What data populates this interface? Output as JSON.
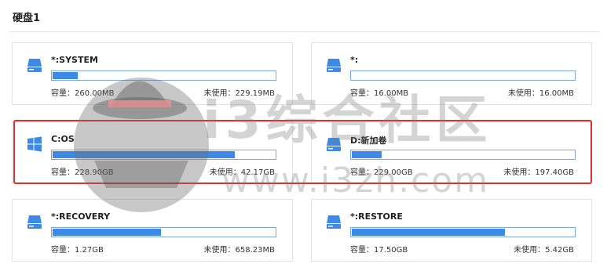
{
  "disk": {
    "title": "硬盘1"
  },
  "partitions": [
    {
      "name": "*:SYSTEM",
      "icon": "drive-icon",
      "usage_fraction": 0.12,
      "capacity": "容量：260.00MB",
      "free": "未使用：229.19MB"
    },
    {
      "name": "*:",
      "icon": "drive-icon",
      "usage_fraction": 0.0,
      "capacity": "容量：16.00MB",
      "free": "未使用：16.00MB"
    },
    {
      "name": "C:OS",
      "icon": "windows-icon",
      "usage_fraction": 0.82,
      "capacity": "容量：228.90GB",
      "free": "未使用：42.17GB"
    },
    {
      "name": "D:新加卷",
      "icon": "drive-icon",
      "usage_fraction": 0.14,
      "capacity": "容量：229.00GB",
      "free": "未使用：197.40GB"
    },
    {
      "name": "*:RECOVERY",
      "icon": "drive-icon",
      "usage_fraction": 0.49,
      "capacity": "容量：1.27GB",
      "free": "未使用：658.23MB"
    },
    {
      "name": "*:RESTORE",
      "icon": "drive-icon",
      "usage_fraction": 0.69,
      "capacity": "容量：17.50GB",
      "free": "未使用：5.42GB"
    }
  ],
  "watermark": {
    "brand": "i3综合社区",
    "url": "www.i3zh.com"
  },
  "colors": {
    "bar_fill": "#3d8ae6",
    "bar_border": "#7ea6d8",
    "drive_icon": "#3d8ae6",
    "highlight": "#e03131"
  }
}
